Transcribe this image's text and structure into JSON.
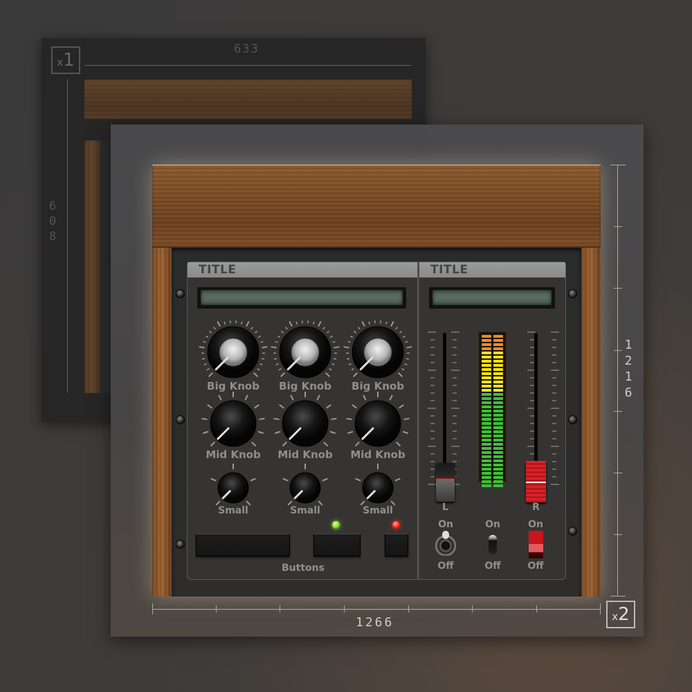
{
  "cards": {
    "x1": {
      "badge_prefix": "x",
      "badge_scale": "1",
      "width_label": "633",
      "height_label": "6\n0\n8"
    },
    "x2": {
      "badge_prefix": "x",
      "badge_scale": "2",
      "width_label": "1266",
      "height_label": "1\n2\n1\n6"
    }
  },
  "plugin": {
    "left_section": {
      "title": "TITLE",
      "display_value": "",
      "big_knobs": [
        {
          "label": "Big Knob"
        },
        {
          "label": "Big Knob"
        },
        {
          "label": "Big Knob"
        }
      ],
      "mid_knobs": [
        {
          "label": "Mid Knob"
        },
        {
          "label": "Mid Knob"
        },
        {
          "label": "Mid Knob"
        }
      ],
      "small_knobs": [
        {
          "label": "Small"
        },
        {
          "label": "Small"
        },
        {
          "label": "Small"
        }
      ],
      "buttons_label": "Buttons",
      "buttons": [
        {
          "name": "wide-button",
          "led": null
        },
        {
          "name": "medium-button",
          "led": "#8fdc3a"
        },
        {
          "name": "small-button",
          "led": "#ff2a20"
        }
      ]
    },
    "right_section": {
      "title": "TITLE",
      "display_value": "",
      "fader_left": {
        "label": "L",
        "level": 0.12
      },
      "fader_right": {
        "label": "R",
        "level": 0.12
      },
      "meter": {
        "orange_segments": 4,
        "yellow_segments": 10,
        "green_segments": 23,
        "colors": {
          "orange": "#f08a22",
          "yellow": "#f2e21a",
          "green": "#3fbf3a"
        }
      },
      "switches": [
        {
          "type": "toggle",
          "on_label": "On",
          "off_label": "Off",
          "state": "on"
        },
        {
          "type": "lever",
          "on_label": "On",
          "off_label": "Off",
          "state": "on"
        },
        {
          "type": "rocker",
          "on_label": "On",
          "off_label": "Off",
          "state": "off"
        }
      ]
    }
  }
}
